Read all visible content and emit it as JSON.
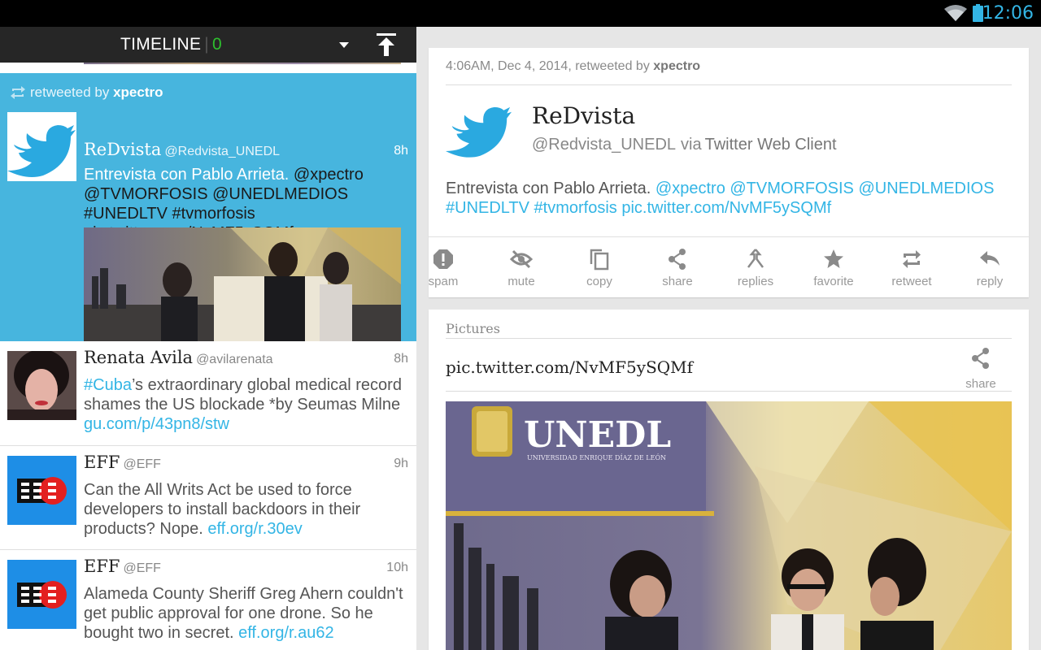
{
  "status_bar": {
    "time": "12:06"
  },
  "timeline_header": {
    "title": "TIMELINE",
    "count": "0"
  },
  "tweets": [
    {
      "retweet_prefix": "retweeted by",
      "retweeter": "xpectro",
      "name": "ReDvista",
      "handle": "@Redvista_UNEDL",
      "time": "8h",
      "text_plain": "Entrevista con Pablo Arrieta. ",
      "mentions": "@xpectro @TVMORFOSIS @UNEDLMEDIOS #UNEDLTV #tvmorfosis pic.twitter.com/NvMF5ySQMf"
    },
    {
      "name": "Renata Avila",
      "handle": "@avilarenata",
      "time": "8h",
      "hashtag": "#Cuba",
      "text": "’s extraordinary global medical record shames the US blockade *by Seumas Milne",
      "link": "gu.com/p/43pn8/stw"
    },
    {
      "name": "EFF",
      "handle": "@EFF",
      "time": "9h",
      "text": "Can the All Writs Act be used to force developers to install backdoors in their products? Nope. ",
      "link": "eff.org/r.30ev"
    },
    {
      "name": "EFF",
      "handle": "@EFF",
      "time": "10h",
      "text": "Alameda County Sheriff Greg Ahern couldn't get public approval for one drone. So he bought two in secret. ",
      "link": "eff.org/r.au62"
    }
  ],
  "detail": {
    "meta_prefix": "4:06AM, Dec 4, 2014, retweeted by",
    "meta_user": "xpectro",
    "name": "ReDvista",
    "handle": "@Redvista_UNEDL",
    "via": "via",
    "client": "Twitter Web Client",
    "text_plain": "Entrevista con Pablo Arrieta. ",
    "text_links": "@xpectro @TVMORFOSIS @UNEDLMEDIOS #UNEDLTV #tvmorfosis pic.twitter.com/NvMF5ySQMf"
  },
  "actions": [
    {
      "label": "spam",
      "icon": "spam-icon"
    },
    {
      "label": "mute",
      "icon": "mute-icon"
    },
    {
      "label": "copy",
      "icon": "copy-icon"
    },
    {
      "label": "share",
      "icon": "share-icon"
    },
    {
      "label": "replies",
      "icon": "replies-icon"
    },
    {
      "label": "favorite",
      "icon": "star-icon"
    },
    {
      "label": "retweet",
      "icon": "retweet-icon"
    },
    {
      "label": "reply",
      "icon": "reply-icon"
    }
  ],
  "pictures": {
    "title": "Pictures",
    "link": "pic.twitter.com/NvMF5ySQMf",
    "share_label": "share",
    "banner_text": "UNEDL",
    "banner_subtext": "UNIVERSIDAD ENRIQUE DÍAZ DE LEÓN"
  },
  "colors": {
    "accent": "#33b5e5",
    "selected_bg": "#47b5de",
    "count_green": "#2ebf2e"
  }
}
